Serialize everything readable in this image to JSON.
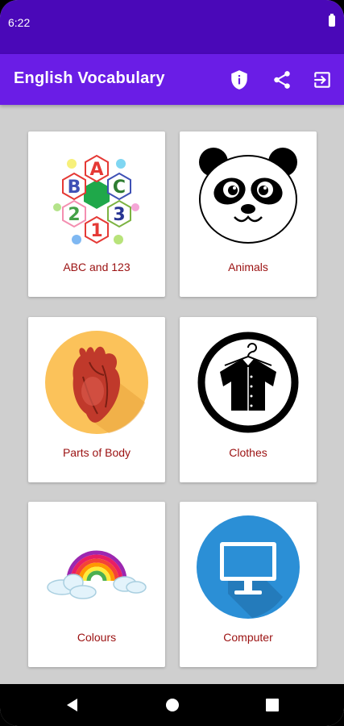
{
  "status_bar": {
    "time": "6:22"
  },
  "app_bar": {
    "title": "English Vocabulary",
    "actions": [
      {
        "icon": "privacy-shield-icon"
      },
      {
        "icon": "share-icon"
      },
      {
        "icon": "exit-icon"
      }
    ]
  },
  "categories": [
    {
      "label": "ABC and 123",
      "icon": "abc-123-hexagons-icon"
    },
    {
      "label": "Animals",
      "icon": "panda-icon"
    },
    {
      "label": "Parts of Body",
      "icon": "heart-organ-icon"
    },
    {
      "label": "Clothes",
      "icon": "shirt-on-hanger-icon"
    },
    {
      "label": "Colours",
      "icon": "rainbow-clouds-icon"
    },
    {
      "label": "Computer",
      "icon": "monitor-icon"
    }
  ],
  "nav_bar": {
    "buttons": [
      "back",
      "home",
      "recents"
    ]
  },
  "colors": {
    "status_bar": "#4a08b8",
    "app_bar": "#6a1de6",
    "card_label": "#9b1111",
    "background": "#cfcfcf"
  }
}
